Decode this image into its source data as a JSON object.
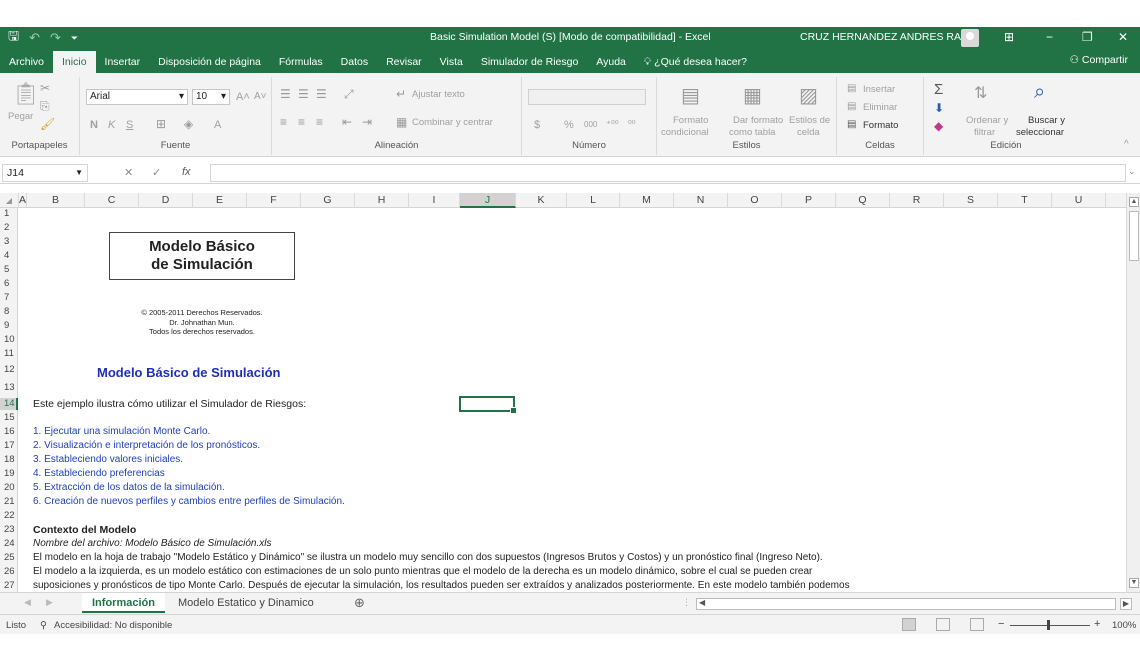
{
  "app": {
    "title": "Basic Simulation Model (S)  [Modo de compatibilidad]  -  Excel",
    "user": "CRUZ HERNANDEZ ANDRES RAUL",
    "window_buttons": {
      "ribbon_display": "⊞",
      "minimize": "−",
      "restore": "❐",
      "close": "✕"
    }
  },
  "quick_access": {
    "save": "🖫",
    "undo": "↶",
    "redo": "↷",
    "customize": "⏷"
  },
  "menu": {
    "tabs": [
      "Archivo",
      "Inicio",
      "Insertar",
      "Disposición de página",
      "Fórmulas",
      "Datos",
      "Revisar",
      "Vista",
      "Simulador de Riesgo",
      "Ayuda",
      "¿Qué desea hacer?"
    ],
    "active_tab": "Inicio",
    "search_icon": "lightbulb-icon",
    "share": "Compartir"
  },
  "ribbon": {
    "clipboard": {
      "paste": "Pegar",
      "label": "Portapapeles"
    },
    "font": {
      "name": "Arial",
      "size": "10",
      "bold": "N",
      "italic": "K",
      "underline": "S",
      "grow": "A˄",
      "shrink": "A˅",
      "label": "Fuente"
    },
    "alignment": {
      "wrap": "Ajustar texto",
      "merge": "Combinar y centrar",
      "label": "Alineación"
    },
    "number": {
      "currency": "$",
      "percent": "%",
      "thousands": "000",
      "inc_dec": "⁺⁰⁰",
      "dec_dec": "⁰⁰",
      "label": "Número"
    },
    "styles": {
      "cond_format_1": "Formato",
      "cond_format_2": "condicional",
      "as_table_1": "Dar formato",
      "as_table_2": "como tabla",
      "cell_styles_1": "Estilos de",
      "cell_styles_2": "celda",
      "label": "Estilos"
    },
    "cells": {
      "insert": "Insertar",
      "delete": "Eliminar",
      "format": "Formato",
      "label": "Celdas"
    },
    "editing": {
      "sort_1": "Ordenar y",
      "sort_2": "filtrar",
      "find_1": "Buscar y",
      "find_2": "seleccionar",
      "label": "Edición"
    }
  },
  "formula_bar": {
    "name_box": "J14",
    "cancel": "✕",
    "enter": "✓",
    "fx": "fx",
    "value": ""
  },
  "columns": [
    "A",
    "B",
    "C",
    "D",
    "E",
    "F",
    "G",
    "H",
    "I",
    "J",
    "K",
    "L",
    "M",
    "N",
    "O",
    "P",
    "Q",
    "R",
    "S",
    "T",
    "U"
  ],
  "selected_column": "J",
  "rows": [
    "1",
    "2",
    "3",
    "4",
    "5",
    "6",
    "7",
    "8",
    "9",
    "10",
    "11",
    "12",
    "13",
    "14",
    "15",
    "16",
    "17",
    "18",
    "19",
    "20",
    "21",
    "22",
    "23",
    "24",
    "25",
    "26",
    "27"
  ],
  "selected_row": "14",
  "sheet": {
    "title_line1": "Modelo Básico",
    "title_line2": "de Simulación",
    "copyright_1": "© 2005-2011 Derechos Reservados.",
    "copyright_2": "Dr. Johnathan Mun.",
    "copyright_3": "Todos los derechos reservados.",
    "heading": "Modelo Básico de Simulación",
    "intro": "Este ejemplo ilustra cómo utilizar el Simulador de Riesgos:",
    "steps": [
      "1. Ejecutar una simulación Monte Carlo.",
      "2. Visualización e interpretación de los pronósticos.",
      "3. Estableciendo valores iniciales.",
      "4. Estableciendo preferencias",
      "5. Extracción de los datos de la simulación.",
      "6. Creación de  nuevos perfiles y cambios entre perfiles de Simulación."
    ],
    "context_title": "Contexto del Modelo",
    "filename": "Nombre del archivo: Modelo Básico de Simulación.xls",
    "body_1": "El modelo en la hoja de trabajo \"Modelo Estático y Dinámico\" se ilustra un modelo muy sencillo con dos supuestos (Ingresos Brutos y Costos) y un pronóstico final (Ingreso Neto).",
    "body_2": "El modelo a la izquierda, es un modelo estático con estimaciones de un solo punto mientras que el modelo de la derecha es un modelo dinámico, sobre el cual se pueden crear",
    "body_3": "suposiciones y pronósticos de tipo Monte Carlo. Después de ejecutar la simulación, los resultados pueden ser extraídos y analizados posteriormente. En este modelo también podemos"
  },
  "sheet_tabs": [
    "Información",
    "Modelo Estatico y Dinamico"
  ],
  "active_sheet": "Información",
  "add_sheet": "⊕",
  "status": {
    "ready": "Listo",
    "accessibility": "Accesibilidad: No disponible",
    "zoom": "100%"
  },
  "colors": {
    "excel_green": "#217346",
    "link_blue": "#1f3fbf",
    "heading_blue": "#1f2fb5"
  }
}
